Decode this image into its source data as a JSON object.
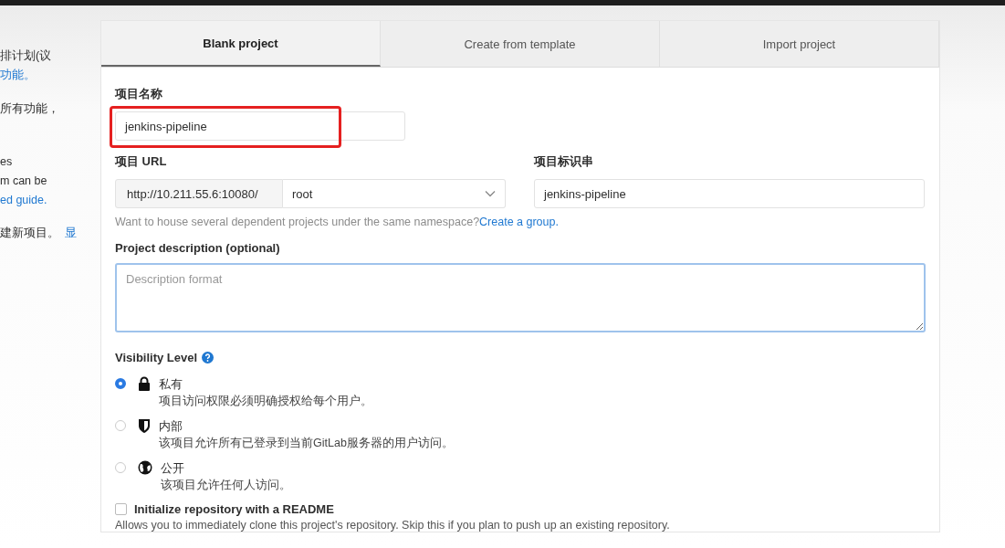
{
  "sidebar": {
    "lines": [
      {
        "parts": [
          {
            "text": "排计划(议",
            "link": false
          }
        ]
      },
      {
        "parts": [
          {
            "text": "功能。",
            "link": true
          }
        ]
      },
      {
        "parts": [
          {
            "text": "所有功能，",
            "link": false
          }
        ]
      },
      {
        "parts": [
          {
            "text": "es",
            "link": false
          }
        ]
      },
      {
        "parts": [
          {
            "text": "m can be",
            "link": false
          }
        ]
      },
      {
        "parts": [
          {
            "text": "ed guide.",
            "link": true
          }
        ]
      },
      {
        "parts": [
          {
            "text": "建新项目。",
            "link": false
          },
          {
            "text": "显",
            "link": true
          }
        ]
      }
    ]
  },
  "tabs": [
    {
      "label": "Blank project",
      "selected": true
    },
    {
      "label": "Create from template",
      "selected": false
    },
    {
      "label": "Import project",
      "selected": false
    }
  ],
  "project_name": {
    "label": "项目名称",
    "value": "jenkins-pipeline",
    "highlighted": true
  },
  "project_url": {
    "label": "项目 URL",
    "prefix": "http://10.211.55.6:10080/",
    "namespace": "root"
  },
  "project_slug": {
    "label": "项目标识串",
    "value": "jenkins-pipeline"
  },
  "namespace_help": {
    "text": "Want to house several dependent projects under the same namespace?",
    "link": "Create a group."
  },
  "description": {
    "label": "Project description (optional)",
    "placeholder": "Description format"
  },
  "visibility": {
    "label": "Visibility Level",
    "options": [
      {
        "kind": "lock",
        "title": "私有",
        "description": "项目访问权限必须明确授权给每个用户。",
        "selected": true
      },
      {
        "kind": "shield",
        "title": "内部",
        "description": "该项目允许所有已登录到当前GitLab服务器的用户访问。",
        "selected": false
      },
      {
        "kind": "globe",
        "title": "公开",
        "description": "该项目允许任何人访问。",
        "selected": false
      }
    ]
  },
  "readme": {
    "label": "Initialize repository with a README",
    "checked": false,
    "help": "Allows you to immediately clone this project's repository. Skip this if you plan to push up an existing repository."
  }
}
